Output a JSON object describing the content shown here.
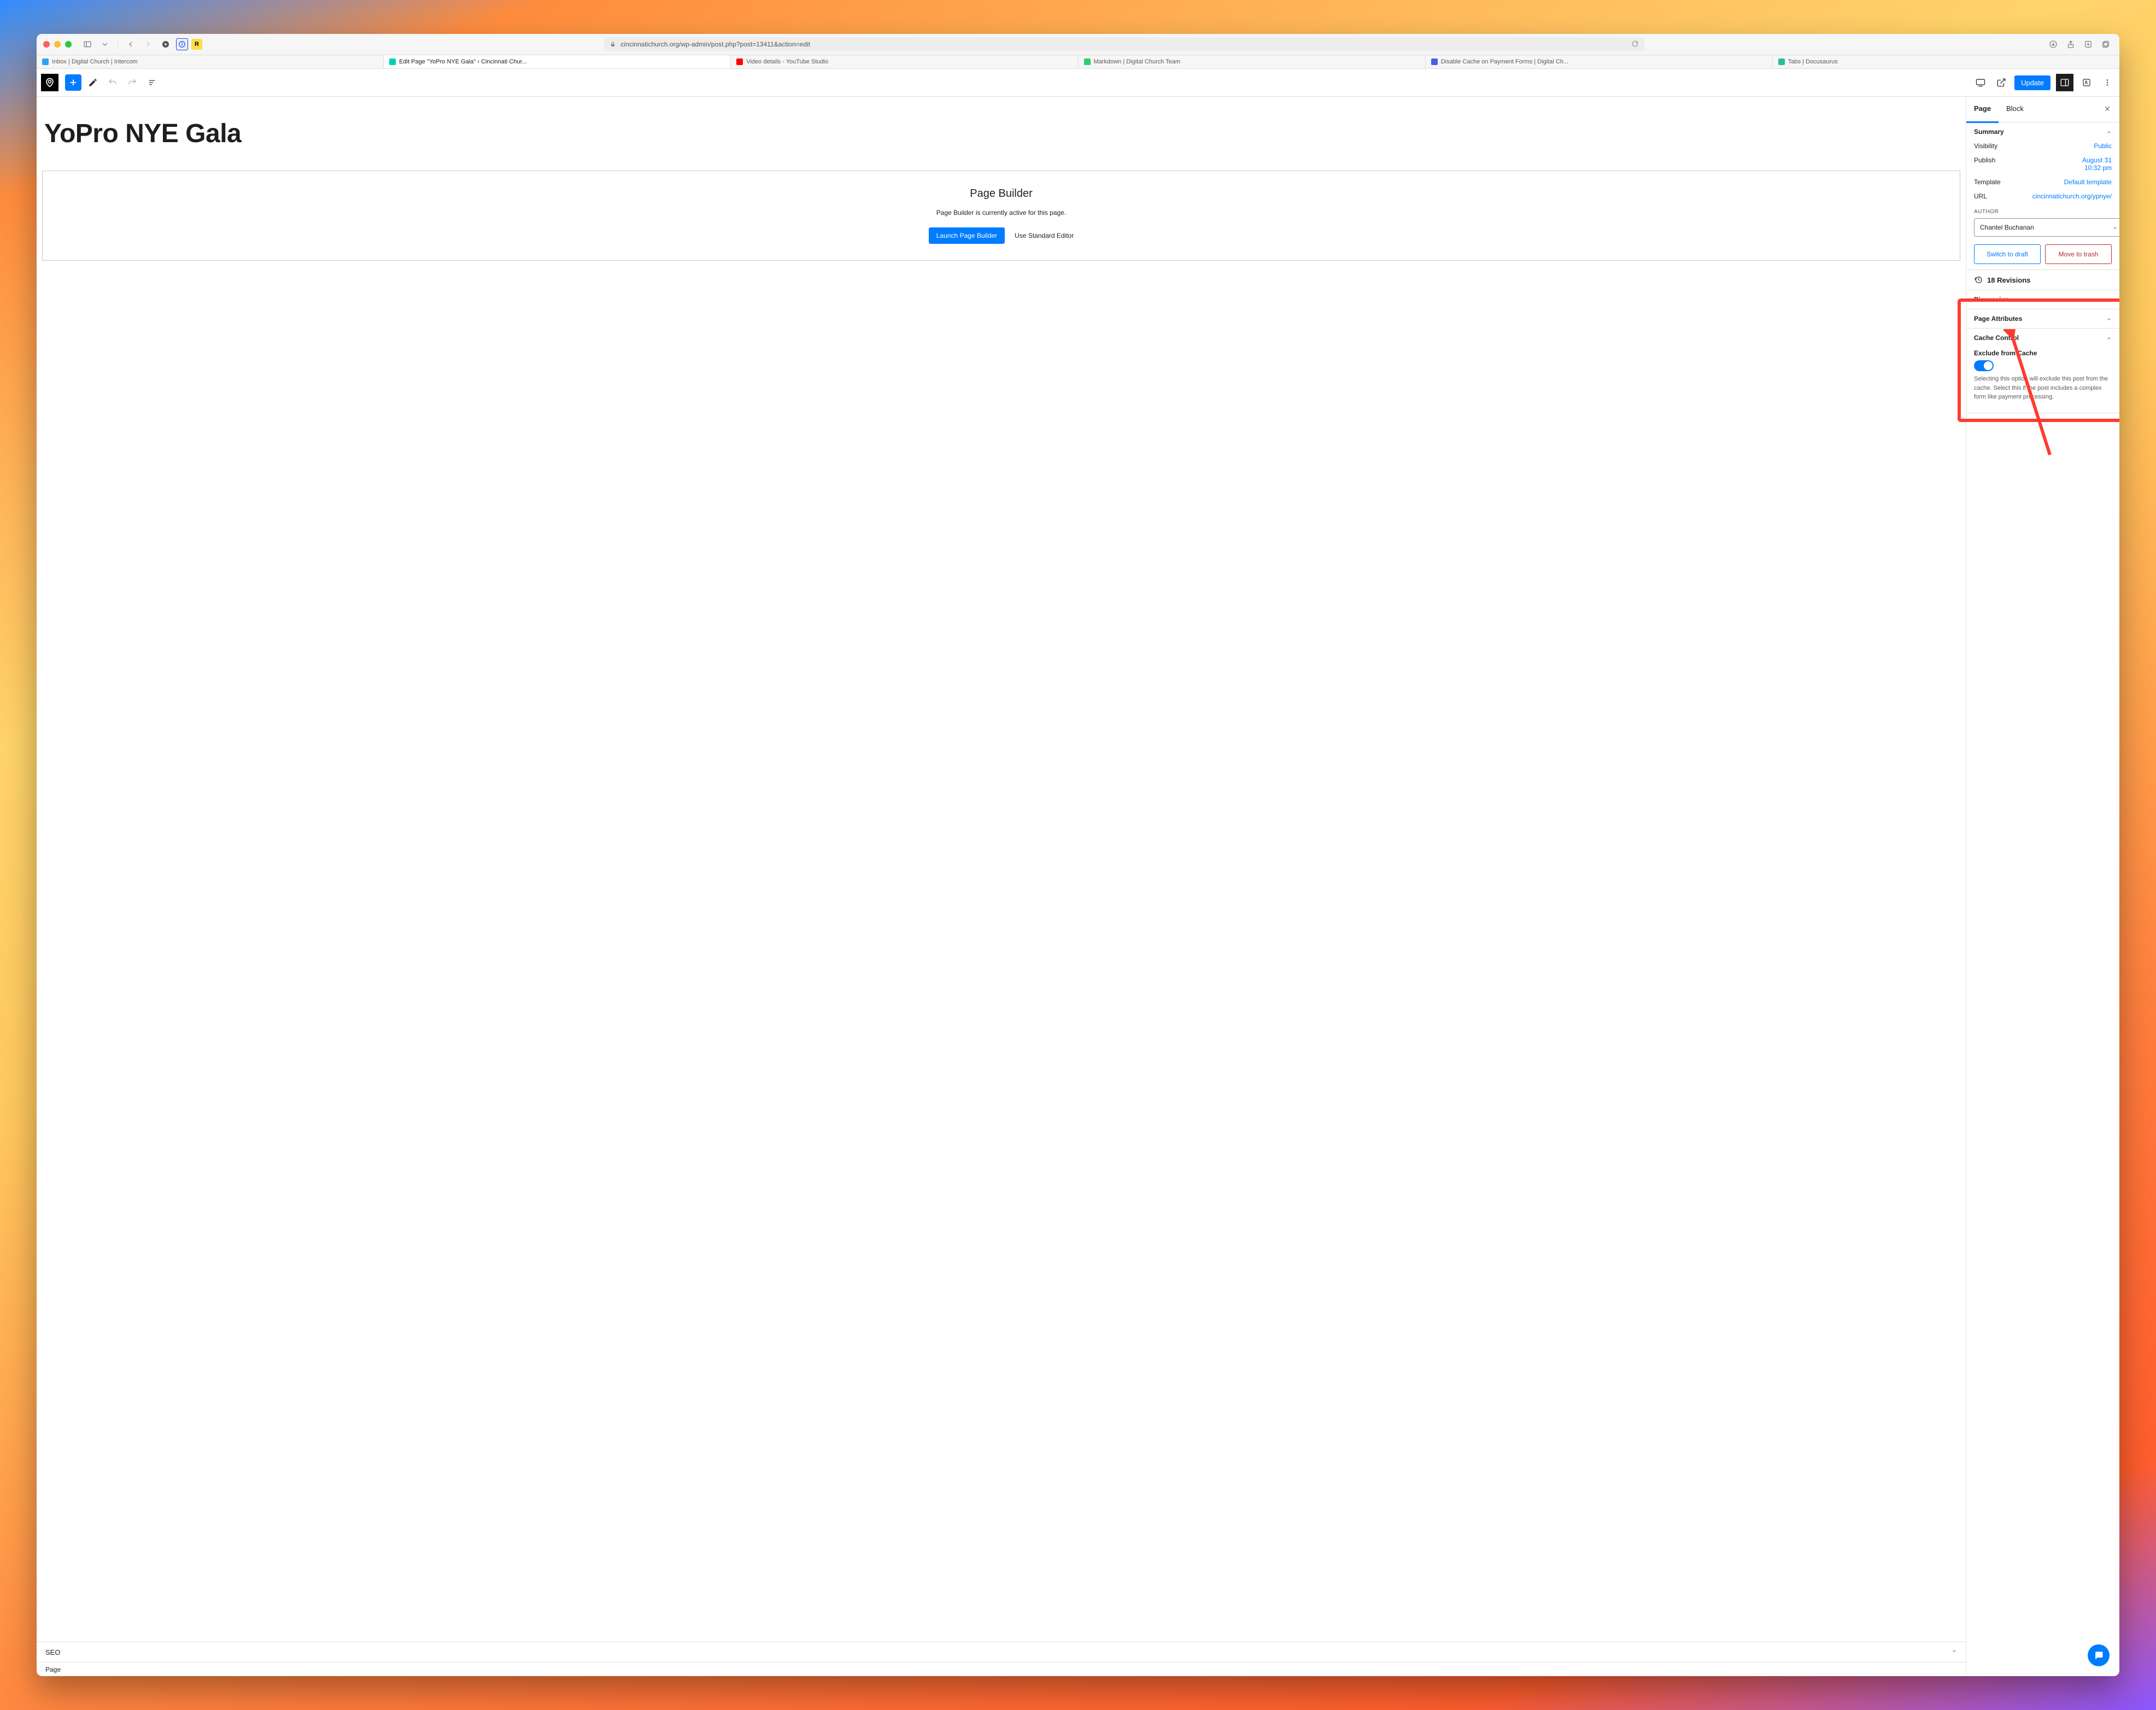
{
  "safari": {
    "url": "cincinnatichurch.org/wp-admin/post.php?post=13411&action=edit",
    "tabs": [
      {
        "label": "Inbox | Digital Church | Intercom",
        "favcolor": "#2ea3f2"
      },
      {
        "label": "Edit Page \"YoPro NYE Gala\" ‹ Cincinnati Chur...",
        "favcolor": "#00d1b2",
        "active": true
      },
      {
        "label": "Video details - YouTube Studio",
        "favcolor": "#ff0000"
      },
      {
        "label": "Markdown | Digital Church Team",
        "favcolor": "#2ecc71"
      },
      {
        "label": "Disable Cache on Payment Forms | Digital Ch...",
        "favcolor": "#4b5ee4"
      },
      {
        "label": "Tabs | Docusaurus",
        "favcolor": "#25c19f"
      }
    ]
  },
  "toolbar": {
    "update_label": "Update"
  },
  "editor": {
    "page_title": "YoPro NYE Gala",
    "beaver": {
      "heading": "Page Builder",
      "desc": "Page Builder is currently active for this page.",
      "launch_label": "Launch Page Builder",
      "standard_label": "Use Standard Editor"
    },
    "seo_label": "SEO",
    "footer_breadcrumb": "Page"
  },
  "sidebar": {
    "tab_page": "Page",
    "tab_block": "Block",
    "summary": {
      "title": "Summary",
      "visibility_label": "Visibility",
      "visibility_value": "Public",
      "publish_label": "Publish",
      "publish_value": "August 31\n10:32 pm",
      "template_label": "Template",
      "template_value": "Default template",
      "url_label": "URL",
      "url_value": "cincinnatichurch.org/ypnye/",
      "author_label": "AUTHOR",
      "author_value": "Chantel Buchanan",
      "switch_draft": "Switch to draft",
      "move_trash": "Move to trash"
    },
    "revisions_label": "18 Revisions",
    "discussion_label": "Discussion",
    "page_attr_label": "Page Attributes",
    "cache": {
      "title": "Cache Control",
      "subtitle": "Exclude from Cache",
      "desc": "Selecting this option will exclude this post from the cache. Select this if the post includes a complex form like payment processing."
    }
  }
}
